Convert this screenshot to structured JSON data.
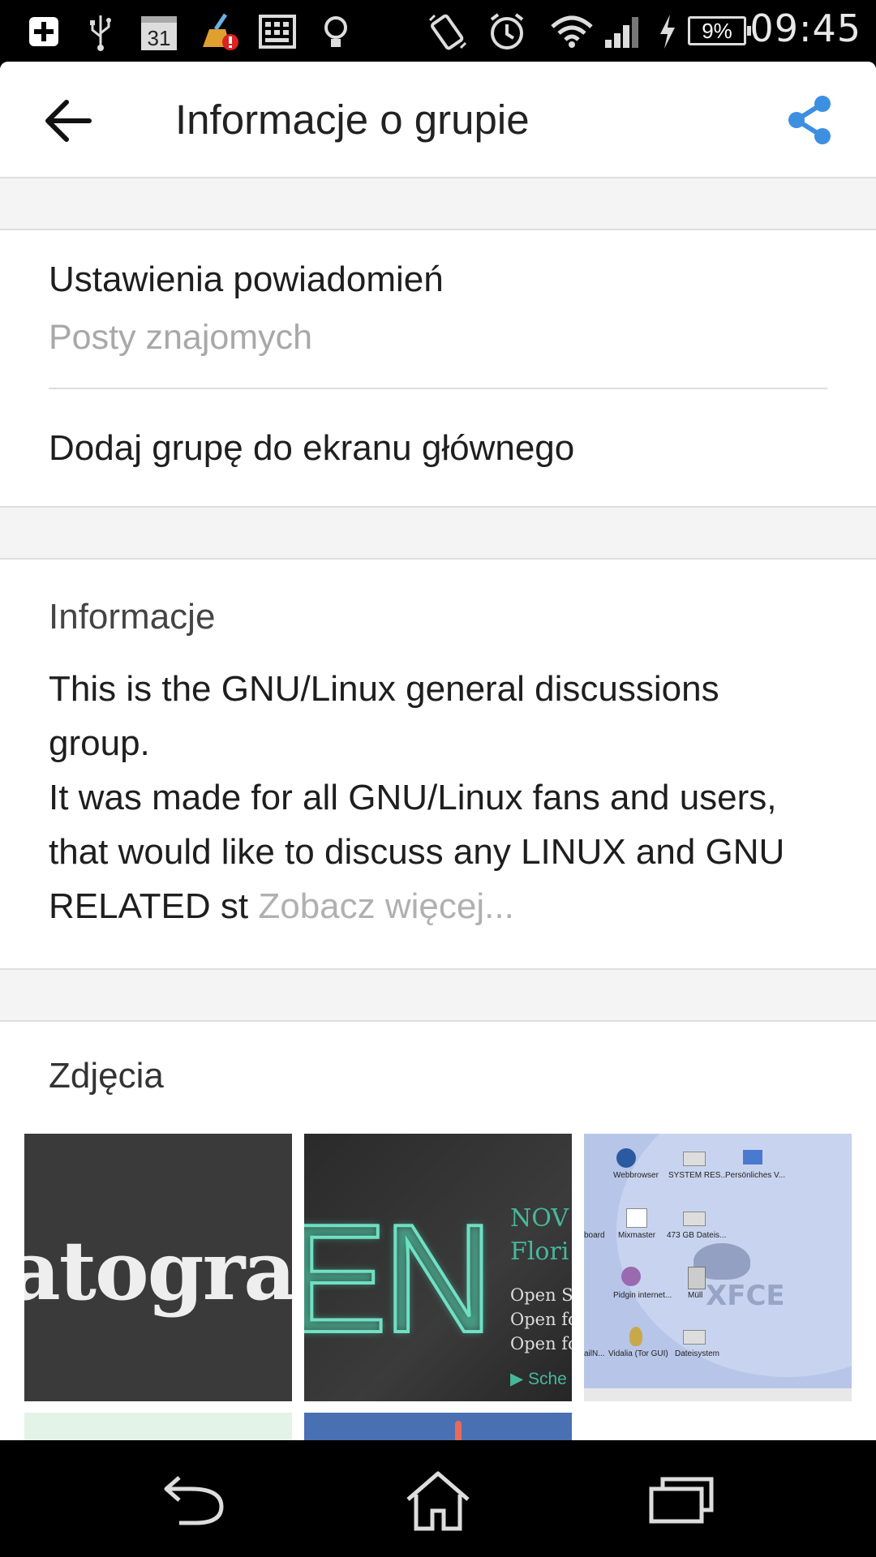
{
  "status_bar": {
    "time": "09:45",
    "battery": "9%",
    "calendar_day": "31",
    "icons": [
      "add-icon",
      "usb-icon",
      "calendar-icon",
      "cleaner-icon",
      "keyboard-icon",
      "lightbulb-icon",
      "rotate-icon",
      "alarm-icon",
      "wifi-icon",
      "signal-icon",
      "charging-icon",
      "battery-icon"
    ]
  },
  "toolbar": {
    "title": "Informacje o grupie",
    "back_icon": "arrow-back-icon",
    "share_icon": "share-icon",
    "accent_color": "#3d8fe0"
  },
  "settings": {
    "notifications_label": "Ustawienia powiadomień",
    "notifications_value": "Posty znajomych",
    "add_to_home_label": "Dodaj grupę do ekranu głównego"
  },
  "info": {
    "heading": "Informacje",
    "description": "This is the GNU/Linux general discussions group.\nIt was made for all GNU/Linux fans and users, that would like to discuss any LINUX and GNU RELATED st ",
    "see_more": "Zobacz więcej..."
  },
  "photos": {
    "heading": "Zdjęcia",
    "thumb1_text": "atogra",
    "thumb2_big": "EN",
    "thumb2_lines": [
      "NOV",
      "Flori",
      "Open Sc",
      "Open fo",
      "Open fo",
      "Sche"
    ],
    "thumb3_icons": [
      "Webbrowser",
      "SYSTEM RES...",
      "Persönliches V...",
      "board",
      "Mixmaster",
      "473 GB Dateis...",
      "Pidgin internet...",
      "Müll",
      "ailN...",
      "Vidalia (Tor GUI)",
      "Dateisystem"
    ],
    "thumb3_logo": "XFCE"
  },
  "nav_bar": {
    "icons": [
      "back-nav-icon",
      "home-nav-icon",
      "recents-nav-icon"
    ]
  }
}
